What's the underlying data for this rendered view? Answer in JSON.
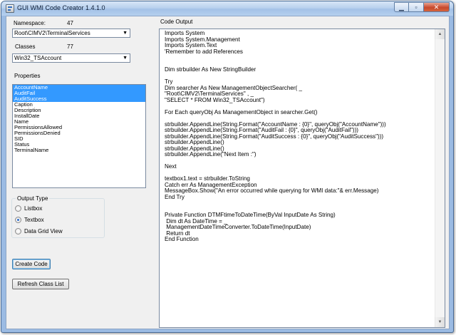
{
  "window": {
    "title": "GUI WMI Code Creator  1.4.1.0",
    "buttons": {
      "minimize": "▁",
      "maximize": "▫",
      "close": "✕"
    }
  },
  "namespace": {
    "label": "Namespace:",
    "count": "47",
    "selected": "Root\\CIMV2\\TerminalServices"
  },
  "classes": {
    "label": "Classes",
    "count": "77",
    "selected": "Win32_TSAccount"
  },
  "properties": {
    "label": "Properties",
    "items": [
      {
        "label": "AccountName",
        "selected": true
      },
      {
        "label": "AuditFail",
        "selected": true
      },
      {
        "label": "AuditSuccess",
        "selected": true
      },
      {
        "label": "Caption",
        "selected": false
      },
      {
        "label": "Description",
        "selected": false
      },
      {
        "label": "InstallDate",
        "selected": false
      },
      {
        "label": "Name",
        "selected": false
      },
      {
        "label": "PermissionsAllowed",
        "selected": false
      },
      {
        "label": "PermissionsDenied",
        "selected": false
      },
      {
        "label": "SID",
        "selected": false
      },
      {
        "label": "Status",
        "selected": false
      },
      {
        "label": "TerminalName",
        "selected": false
      }
    ]
  },
  "output_type": {
    "label": "Output Type",
    "options": [
      {
        "label": "Listbox",
        "checked": false
      },
      {
        "label": "Textbox",
        "checked": true
      },
      {
        "label": "Data Grid View",
        "checked": false
      }
    ]
  },
  "buttons": {
    "create_code": "Create Code",
    "refresh_class_list": "Refresh Class List"
  },
  "code_output": {
    "label": "Code Output",
    "lines": [
      "Imports System",
      "Imports System.Management",
      "Imports System.Text",
      "'Remember to add References",
      "",
      "",
      "Dim strbuilder As New StringBuilder",
      "",
      "Try",
      "Dim searcher As New ManagementObjectSearcher( _",
      "\"Root\\CIMV2\\TerminalServices\" , _",
      "\"SELECT * FROM Win32_TSAccount\")",
      "",
      "For Each queryObj As ManagementObject in searcher.Get()",
      "",
      "strbuilder.AppendLine(String.Format(\"AccountName : {0}\", queryObj(\"AccountName\")))",
      "strbuilder.AppendLine(String.Format(\"AuditFail : {0}\", queryObj(\"AuditFail\")))",
      "strbuilder.AppendLine(String.Format(\"AuditSuccess : {0}\", queryObj(\"AuditSuccess\")))",
      "strbuilder.AppendLine()",
      "strbuilder.AppendLine()",
      "strbuilder.AppendLine(\"Next Item :\")",
      "",
      "Next",
      "",
      "textbox1.text = strbuilder.ToString",
      "Catch err As ManagementException",
      "MessageBox.Show(\"An error occurred while querying for WMI data:\"& err.Message)",
      "End Try",
      "",
      "",
      "Private Function DTMFtimeToDateTime(ByVal InputDate As String)",
      " Dim dt As DateTime = _",
      " ManagementDateTimeConverter.ToDateTime(InputDate)",
      " Return dt",
      "End Function"
    ]
  },
  "colors": {
    "selection": "#3399ff",
    "window_frame": "#9bbbe3",
    "client_bg": "#f0f0f0"
  }
}
